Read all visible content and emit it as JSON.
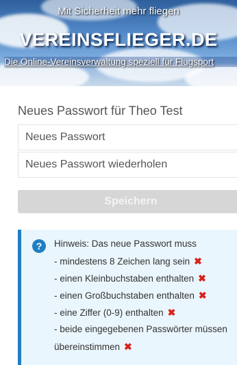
{
  "banner": {
    "tagline": "Mit Sicherheit mehr fliegen",
    "logo": "VEREINSFLIEGER.DE",
    "subtitle": "Die Online-Vereinsverwaltung speziell für Flugsport"
  },
  "form": {
    "title": "Neues Passwort für Theo Test",
    "new_password_placeholder": "Neues Passwort",
    "repeat_password_placeholder": "Neues Passwort wiederholen",
    "save_label": "Speichern"
  },
  "info": {
    "icon": "question-circle-icon",
    "hint": "Hinweis: Das neue Passwort muss",
    "requirements": [
      "- mindestens 8 Zeichen lang sein",
      "- einen Kleinbuchstaben enthalten",
      "- einen Großbuchstaben enthalten",
      "- eine Ziffer (0-9) enthalten",
      "- beide eingegebenen Passwörter müssen",
      "übereinstimmen"
    ],
    "fail_mark": "✖"
  },
  "colors": {
    "info_accent": "#1f7fc4",
    "info_background": "#eaf6fd",
    "fail_red": "#d8211b",
    "button_disabled": "#d6d6d6"
  }
}
